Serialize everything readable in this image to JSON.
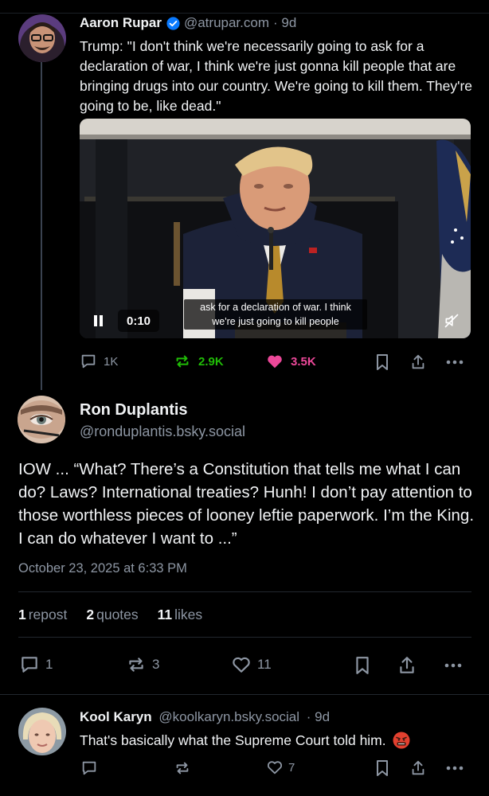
{
  "parent_post": {
    "author_name": "Aaron Rupar",
    "author_handle": "@atrupar.com",
    "age": "· 9d",
    "text": "Trump: \"I don't think we're necessarily going to ask for a declaration of war, I think we're just gonna kill people that are bringing drugs into our country. We're going to kill them. They're going to be, like dead.\"",
    "video": {
      "time": "0:10",
      "caption": "ask for a declaration of war. I think we're just going to kill people"
    },
    "actions": {
      "replies": "1K",
      "reposts": "2.9K",
      "likes": "3.5K"
    }
  },
  "main_post": {
    "author_name": "Ron Duplantis",
    "author_handle": "@ronduplantis.bsky.social",
    "text": "IOW ... “What? There’s a Constitution that tells me what I can do? Laws? International treaties? Hunh! I don’t pay attention to those worthless pieces of looney leftie paperwork. I’m the King. I can do whatever I want to ...”",
    "timestamp": "October 23, 2025 at 6:33 PM",
    "stats": {
      "reposts_count": "1",
      "reposts_label": "repost",
      "quotes_count": "2",
      "quotes_label": "quotes",
      "likes_count": "11",
      "likes_label": "likes"
    },
    "actions": {
      "replies": "1",
      "reposts": "3",
      "likes": "11"
    }
  },
  "reply_post": {
    "author_name": "Kool Karyn",
    "author_handle": "@koolkaryn.bsky.social",
    "age": "· 9d",
    "text": "That's basically what the Supreme Court told him.",
    "actions": {
      "likes": "7"
    }
  },
  "icons": {
    "reply": "speech-bubble-icon",
    "repost": "repost-arrows-icon",
    "like": "heart-icon",
    "bookmark": "bookmark-icon",
    "share": "share-icon",
    "more": "more-dots-icon",
    "verified": "verified-check-icon",
    "pause": "pause-icon",
    "mute": "muted-speaker-icon",
    "emoji": "angry-face-emoji"
  },
  "colors": {
    "background": "#000000",
    "text": "#f1f3f5",
    "muted": "#8d96a3",
    "repost_active": "#20bc07",
    "like_active": "#ec4899",
    "verified": "#0a7aff"
  }
}
